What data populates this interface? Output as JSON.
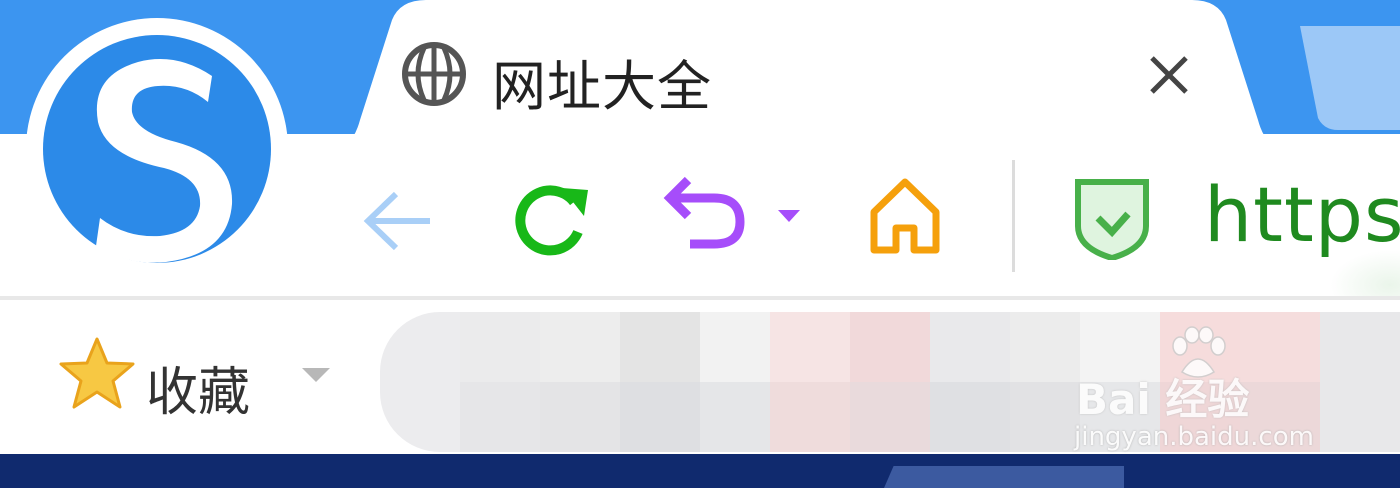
{
  "tab": {
    "title": "网址大全",
    "icon": "globe-icon",
    "close_icon": "close-icon"
  },
  "toolbar": {
    "back_icon": "back-arrow-icon",
    "reload_icon": "reload-icon",
    "undo_icon": "undo-icon",
    "home_icon": "home-icon",
    "security_icon": "shield-check-icon",
    "url_text": "https:/",
    "colors": {
      "back": "#a9cff7",
      "reload": "#18b818",
      "undo": "#a64dfa",
      "home": "#f5a00c",
      "shield": "#48b04a",
      "url": "#1f8a1f"
    }
  },
  "bookmarks": {
    "favorites_label": "收藏",
    "favorites_icon": "star-icon"
  },
  "watermark": {
    "brand": "Bai 经验",
    "url": "jingyan.baidu.com",
    "paw_icon": "paw-icon"
  },
  "colors": {
    "tabstrip": "#3c95f0",
    "bottom_bar": "#102a6e"
  }
}
